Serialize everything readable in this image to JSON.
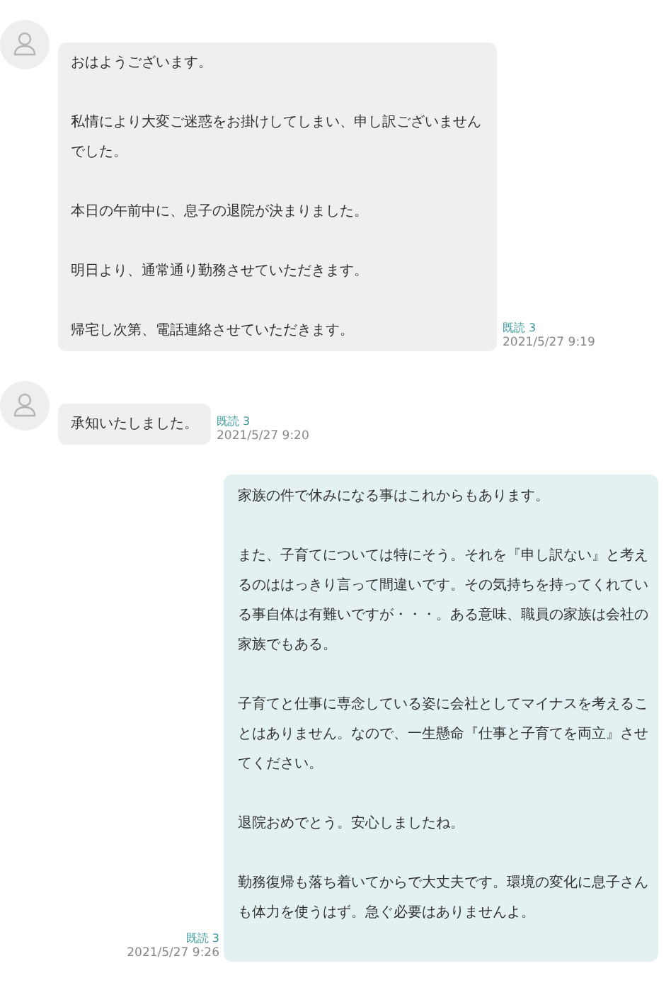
{
  "messages": [
    {
      "kind": "received",
      "paragraphs": [
        "おはようございます。",
        "私情により大変ご迷惑をお掛けしてしまい、申し訳ございませんでした。",
        "本日の午前中に、息子の退院が決まりました。",
        "明日より、通常通り勤務させていただきます。",
        "帰宅し次第、電話連絡させていただきます。"
      ],
      "read": "既読 3",
      "time": "2021/5/27 9:19"
    },
    {
      "kind": "received",
      "paragraphs": [
        "承知いたしました。"
      ],
      "read": "既読 3",
      "time": "2021/5/27 9:20"
    },
    {
      "kind": "sent",
      "paragraphs": [
        "家族の件で休みになる事はこれからもあります。",
        "また、子育てについては特にそう。それを『申し訳ない』と考えるのははっきり言って間違いです。その気持ちを持ってくれている事自体は有難いですが・・・。ある意味、職員の家族は会社の家族でもある。",
        "子育てと仕事に専念している姿に会社としてマイナスを考えることはありません。なので、一生懸命『仕事と子育てを両立』させてください。",
        "退院おめでとう。安心しましたね。",
        "勤務復帰も落ち着いてからで大丈夫です。環境の変化に息子さんも体力を使うはず。急ぐ必要はありませんよ。"
      ],
      "read": "既読 3",
      "time": "2021/5/27 9:26"
    }
  ]
}
